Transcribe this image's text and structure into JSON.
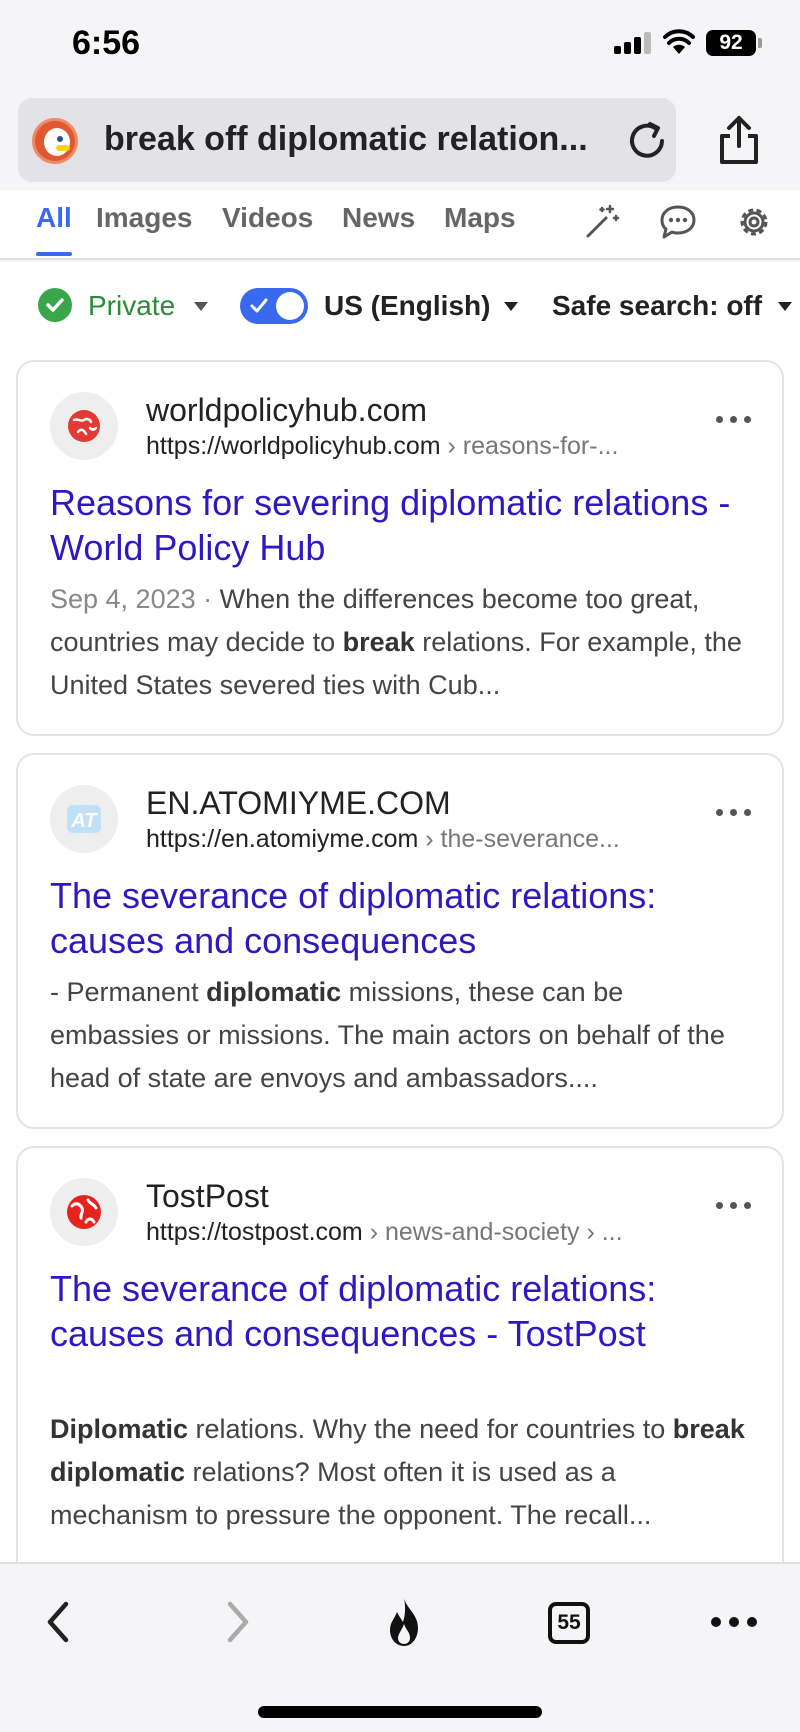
{
  "status_bar": {
    "time": "6:56",
    "battery": "92"
  },
  "search": {
    "query": "break off diplomatic relation..."
  },
  "tabs": [
    {
      "label": "All",
      "active": true
    },
    {
      "label": "Images"
    },
    {
      "label": "Videos"
    },
    {
      "label": "News"
    },
    {
      "label": "Maps"
    }
  ],
  "filters": {
    "privacy": "Private",
    "region": "US (English)",
    "safe_search": "Safe search: off"
  },
  "results": [
    {
      "site_name": "worldpolicyhub.com",
      "url": "https://worldpolicyhub.com",
      "url_path": " › reasons-for-...",
      "title": "Reasons for severing diplomatic relations - World Policy Hub",
      "date": "Sep 4, 2023",
      "date_sep": " · ",
      "snippet_parts": [
        {
          "text": "When the differences become too great, countries may decide to ",
          "bold": false
        },
        {
          "text": "break",
          "bold": true
        },
        {
          "text": " relations. For example, the United States severed ties with Cub...",
          "bold": false
        }
      ]
    },
    {
      "site_name": "EN.ATOMIYME.COM",
      "url": "https://en.atomiyme.com",
      "url_path": " › the-severance...",
      "title": "The severance of diplomatic relations: causes and consequences",
      "snippet_parts": [
        {
          "text": "- Permanent ",
          "bold": false
        },
        {
          "text": "diplomatic",
          "bold": true
        },
        {
          "text": " missions, these can be embassies or missions. The main actors on behalf of the head of state are envoys and ambassadors....",
          "bold": false
        }
      ]
    },
    {
      "site_name": "TostPost",
      "url": "https://tostpost.com",
      "url_path": " › news-and-society › ...",
      "title": "The severance of diplomatic relations: causes and consequences - TostPost",
      "snippet_parts": [
        {
          "text": "Diplomatic",
          "bold": true
        },
        {
          "text": " relations. Why the need for countries to ",
          "bold": false
        },
        {
          "text": "break diplomatic",
          "bold": true
        },
        {
          "text": " relations? Most often it is used as a mechanism to pressure the opponent. The recall...",
          "bold": false
        }
      ]
    }
  ],
  "bottom_bar": {
    "tab_count": "55"
  },
  "colors": {
    "accent": "#3969ef",
    "link": "#2f18c2",
    "private_green": "#3aa64a",
    "ddg_orange": "#de5833"
  },
  "icons": [
    "reload-icon",
    "share-icon",
    "magic-wand-icon",
    "chat-icon",
    "gear-icon",
    "back-icon",
    "forward-icon",
    "fire-icon",
    "more-icon"
  ]
}
